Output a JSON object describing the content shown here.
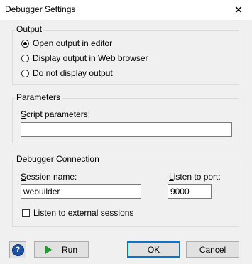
{
  "window": {
    "title": "Debugger Settings",
    "close_glyph": "✕"
  },
  "output": {
    "title": "Output",
    "options": [
      {
        "label": "Open output in editor",
        "checked": true
      },
      {
        "label": "Display output in Web browser",
        "checked": false
      },
      {
        "label": "Do not display output",
        "checked": false
      }
    ]
  },
  "parameters": {
    "title": "Parameters",
    "script_label": "Script parameters:",
    "script_value": ""
  },
  "connection": {
    "title": "Debugger Connection",
    "session_label": "Session name:",
    "session_value": "webuilder",
    "port_label": "Listen to port:",
    "port_value": "9000",
    "external_label": "Listen to external sessions",
    "external_checked": false
  },
  "buttons": {
    "run": "Run",
    "ok": "OK",
    "cancel": "Cancel",
    "help_glyph": "?"
  }
}
